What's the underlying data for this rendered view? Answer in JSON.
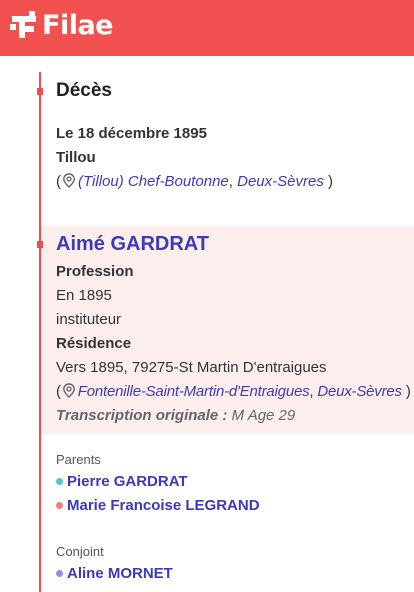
{
  "app": {
    "logo_text": "Filae"
  },
  "colors": {
    "brand": "#f1524f",
    "timeline": "#ee4b4b",
    "link": "#3c3ab8",
    "highlight_bg": "#fdeeee",
    "parent_dot_father": "#5bc6c8",
    "parent_dot_mother": "#f08080",
    "spouse_dot": "#8e8ef0"
  },
  "deces": {
    "title": "Décès",
    "date": "Le 18 décembre 1895",
    "place": "Tillou",
    "open_paren": "(",
    "commune_link": "(Tillou) Chef-Boutonne",
    "comma": ",",
    "dept_link": "Deux-Sèvres",
    "close_paren": ")"
  },
  "person": {
    "name": "Aimé GARDRAT",
    "profession_label": "Profession",
    "profession_year": "En 1895",
    "profession_value": "instituteur",
    "residence_label": "Résidence",
    "residence_value": "Vers 1895, 79275-St Martin D'entraigues",
    "open_paren": "(",
    "residence_commune_link": "Fontenille-Saint-Martin-d'Entraigues",
    "comma": ",",
    "residence_dept_link": "Deux-Sèvres",
    "close_paren": ")",
    "transcription_label": "Transcription originale :",
    "transcription_value": "M Age 29"
  },
  "parents": {
    "label": "Parents",
    "father": "Pierre GARDRAT",
    "mother": "Marie Francoise LEGRAND"
  },
  "spouse": {
    "label": "Conjoint",
    "name": "Aline MORNET"
  }
}
